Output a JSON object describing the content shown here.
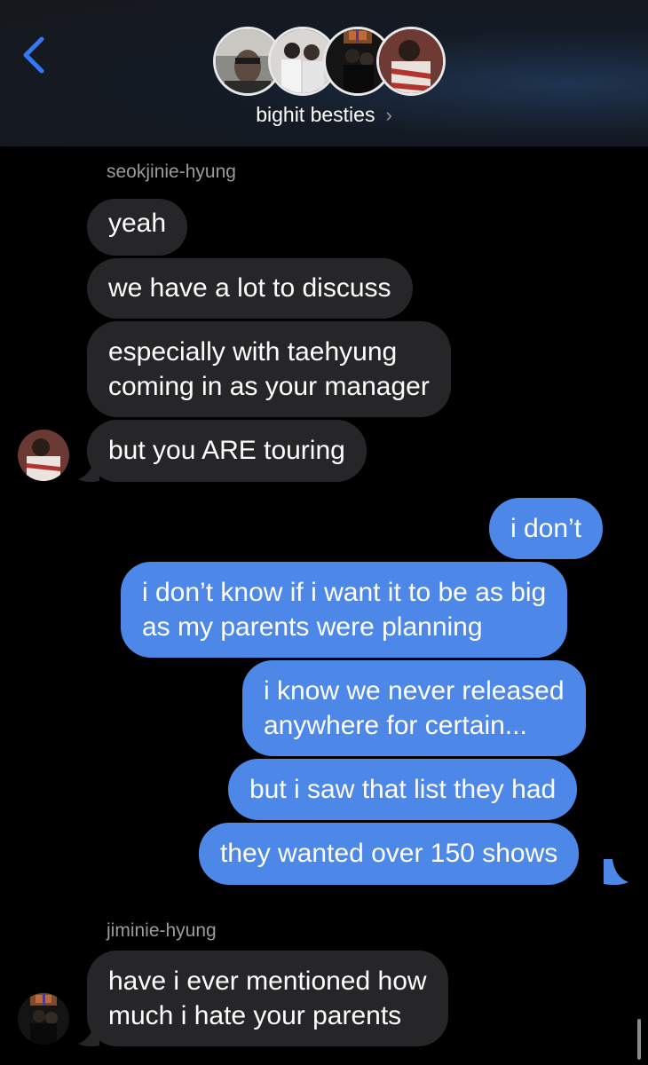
{
  "header": {
    "group_name": "bighit besties",
    "chevron": "›",
    "back_icon": "chevron-left-icon",
    "accent": "#3478f6"
  },
  "messages": [
    {
      "sender": "seokjinie-hyung"
    },
    {
      "text": "yeah"
    },
    {
      "text": "we have a lot to discuss"
    },
    {
      "lines": [
        "especially with taehyung",
        "coming in as your manager"
      ]
    },
    {
      "text": "but you ARE touring"
    },
    {
      "text": "i don’t"
    },
    {
      "lines": [
        "i don’t know if i want it to be as big",
        "as my parents were planning"
      ]
    },
    {
      "lines": [
        "i know we never released",
        "anywhere for certain..."
      ]
    },
    {
      "text": "but i saw that list they had"
    },
    {
      "text": "they wanted over 150 shows"
    },
    {
      "sender": "jiminie-hyung"
    },
    {
      "lines": [
        "have i ever mentioned how",
        "much i hate your parents"
      ]
    }
  ],
  "colors": {
    "incoming_bubble": "#262629",
    "outgoing_bubble": "#4d88e8",
    "background": "#000000"
  }
}
